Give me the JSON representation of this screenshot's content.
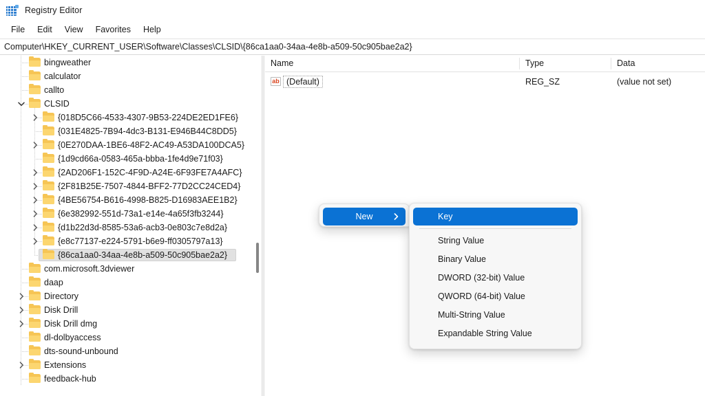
{
  "window": {
    "title": "Registry Editor",
    "icon": "registry-icon"
  },
  "menubar": {
    "items": [
      {
        "label": "File"
      },
      {
        "label": "Edit"
      },
      {
        "label": "View"
      },
      {
        "label": "Favorites"
      },
      {
        "label": "Help"
      }
    ]
  },
  "address": {
    "path": "Computer\\HKEY_CURRENT_USER\\Software\\Classes\\CLSID\\{86ca1aa0-34aa-4e8b-a509-50c905bae2a2}"
  },
  "tree": {
    "items": [
      {
        "label": "bingweather",
        "depth": 1,
        "expander": "none",
        "selected": false
      },
      {
        "label": "calculator",
        "depth": 1,
        "expander": "none",
        "selected": false
      },
      {
        "label": "callto",
        "depth": 1,
        "expander": "none",
        "selected": false
      },
      {
        "label": "CLSID",
        "depth": 1,
        "expander": "expanded",
        "selected": false
      },
      {
        "label": "{018D5C66-4533-4307-9B53-224DE2ED1FE6}",
        "depth": 2,
        "expander": "collapsed",
        "selected": false
      },
      {
        "label": "{031E4825-7B94-4dc3-B131-E946B44C8DD5}",
        "depth": 2,
        "expander": "none",
        "selected": false
      },
      {
        "label": "{0E270DAA-1BE6-48F2-AC49-A53DA100DCA5}",
        "depth": 2,
        "expander": "collapsed",
        "selected": false
      },
      {
        "label": "{1d9cd66a-0583-465a-bbba-1fe4d9e71f03}",
        "depth": 2,
        "expander": "none",
        "selected": false
      },
      {
        "label": "{2AD206F1-152C-4F9D-A24E-6F93FE7A4AFC}",
        "depth": 2,
        "expander": "collapsed",
        "selected": false
      },
      {
        "label": "{2F81B25E-7507-4844-BFF2-77D2CC24CED4}",
        "depth": 2,
        "expander": "collapsed",
        "selected": false
      },
      {
        "label": "{4BE56754-B616-4998-B825-D16983AEE1B2}",
        "depth": 2,
        "expander": "collapsed",
        "selected": false
      },
      {
        "label": "{6e382992-551d-73a1-e14e-4a65f3fb3244}",
        "depth": 2,
        "expander": "collapsed",
        "selected": false
      },
      {
        "label": "{d1b22d3d-8585-53a6-acb3-0e803c7e8d2a}",
        "depth": 2,
        "expander": "collapsed",
        "selected": false
      },
      {
        "label": "{e8c77137-e224-5791-b6e9-ff0305797a13}",
        "depth": 2,
        "expander": "collapsed",
        "selected": false
      },
      {
        "label": "{86ca1aa0-34aa-4e8b-a509-50c905bae2a2}",
        "depth": 2,
        "expander": "none",
        "selected": true
      },
      {
        "label": "com.microsoft.3dviewer",
        "depth": 1,
        "expander": "none",
        "selected": false
      },
      {
        "label": "daap",
        "depth": 1,
        "expander": "none",
        "selected": false
      },
      {
        "label": "Directory",
        "depth": 1,
        "expander": "collapsed",
        "selected": false
      },
      {
        "label": "Disk Drill",
        "depth": 1,
        "expander": "collapsed",
        "selected": false
      },
      {
        "label": "Disk Drill dmg",
        "depth": 1,
        "expander": "collapsed",
        "selected": false
      },
      {
        "label": "dl-dolbyaccess",
        "depth": 1,
        "expander": "none",
        "selected": false
      },
      {
        "label": "dts-sound-unbound",
        "depth": 1,
        "expander": "none",
        "selected": false
      },
      {
        "label": "Extensions",
        "depth": 1,
        "expander": "collapsed",
        "selected": false
      },
      {
        "label": "feedback-hub",
        "depth": 1,
        "expander": "none",
        "selected": false
      }
    ]
  },
  "list": {
    "columns": [
      {
        "label": "Name"
      },
      {
        "label": "Type"
      },
      {
        "label": "Data"
      }
    ],
    "rows": [
      {
        "icon": "string-value-icon",
        "icon_text": "ab",
        "name": "(Default)",
        "type": "REG_SZ",
        "data": "(value not set)"
      }
    ]
  },
  "context_menu": {
    "parent": {
      "items": [
        {
          "label": "New",
          "highlight": true,
          "submenu": true
        }
      ]
    },
    "submenu": {
      "items": [
        {
          "label": "Key",
          "highlight": true,
          "separator_after": true
        },
        {
          "label": "String Value",
          "highlight": false,
          "separator_after": false
        },
        {
          "label": "Binary Value",
          "highlight": false,
          "separator_after": false
        },
        {
          "label": "DWORD (32-bit) Value",
          "highlight": false,
          "separator_after": false
        },
        {
          "label": "QWORD (64-bit) Value",
          "highlight": false,
          "separator_after": false
        },
        {
          "label": "Multi-String Value",
          "highlight": false,
          "separator_after": false
        },
        {
          "label": "Expandable String Value",
          "highlight": false,
          "separator_after": false
        }
      ]
    }
  },
  "colors": {
    "accent": "#0b72d4",
    "folder": "#fcd670",
    "selection": "#e1e1e1",
    "string_icon": "#d9441f"
  }
}
